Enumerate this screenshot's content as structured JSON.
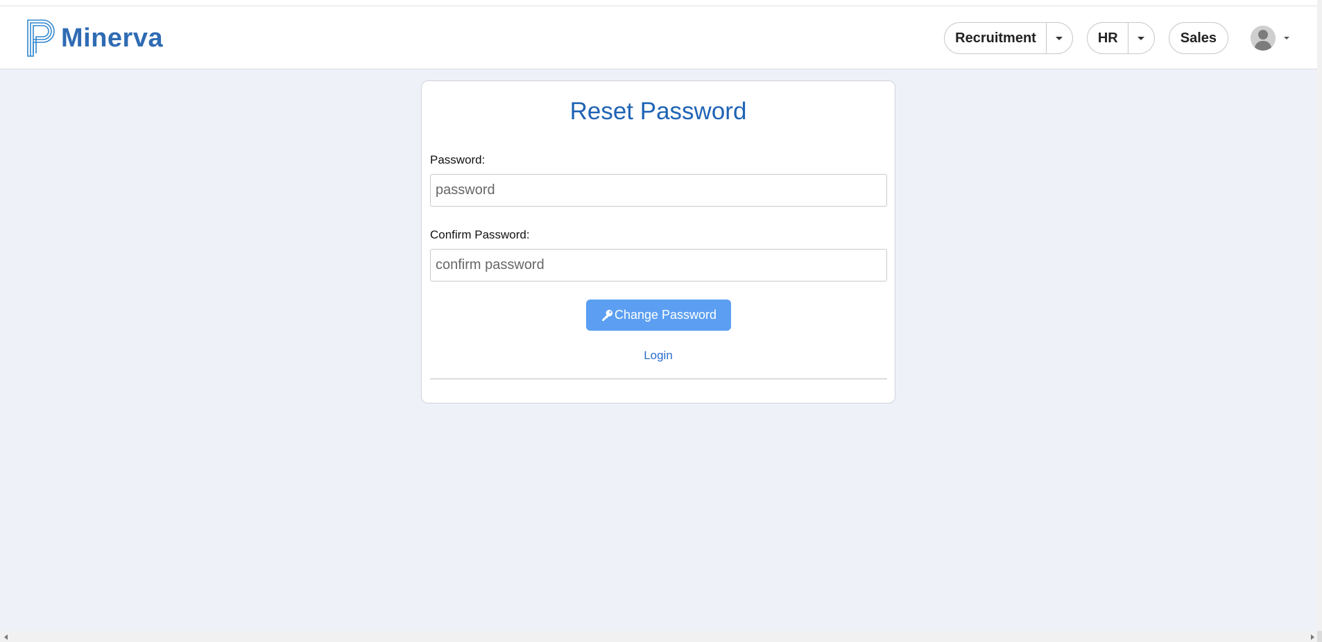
{
  "brand": {
    "name": "Minerva",
    "logo_icon": "minerva-logo-icon",
    "color": "#2f6bb3"
  },
  "nav": {
    "recruitment_label": "Recruitment",
    "hr_label": "HR",
    "sales_label": "Sales",
    "user_icon": "user-avatar-icon"
  },
  "form": {
    "title": "Reset Password",
    "password_label": "Password:",
    "password_placeholder": "password",
    "password_value": "",
    "confirm_label": "Confirm Password:",
    "confirm_placeholder": "confirm password",
    "confirm_value": "",
    "submit_label": "Change Password",
    "submit_icon": "key-icon",
    "login_link": "Login"
  },
  "colors": {
    "accent": "#1f63b5",
    "button": "#5c9ff2",
    "link": "#2a6dcc",
    "background": "#eef1f8"
  }
}
